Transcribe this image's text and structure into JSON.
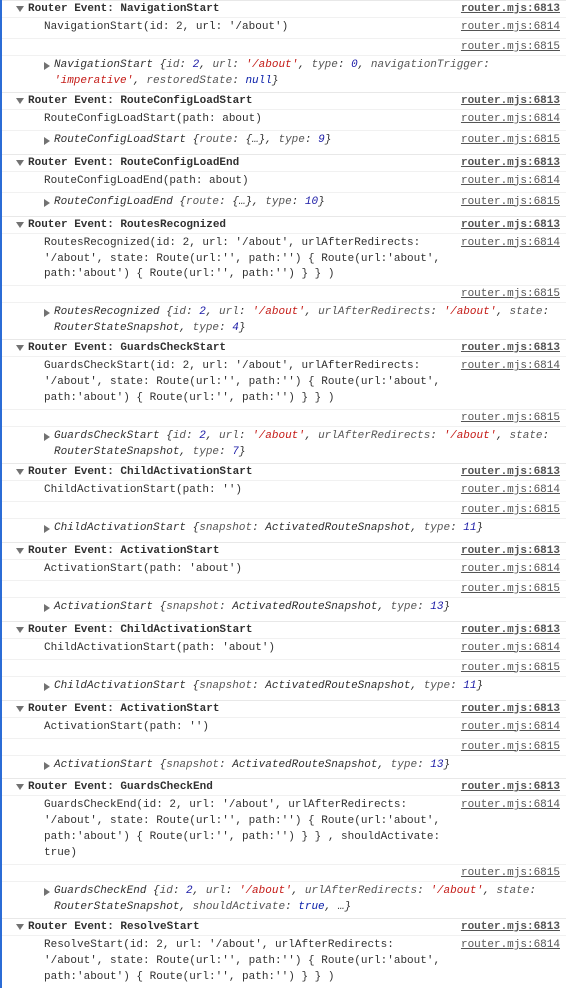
{
  "sources": {
    "s6813": "router.mjs:6813",
    "s6814": "router.mjs:6814",
    "s6815": "router.mjs:6815"
  },
  "groups": [
    {
      "title": "Router Event: NavigationStart",
      "headerSrc": "s6813",
      "rows": [
        {
          "type": "msg",
          "text": "NavigationStart(id: 2, url: '/about')",
          "src": "s6814"
        },
        {
          "type": "srcOnly",
          "src": "s6815"
        },
        {
          "type": "obj",
          "src": null,
          "segments": [
            {
              "t": "plain",
              "v": "NavigationStart {"
            },
            {
              "t": "key",
              "v": "id"
            },
            {
              "t": "plain",
              "v": ": "
            },
            {
              "t": "num",
              "v": "2"
            },
            {
              "t": "plain",
              "v": ", "
            },
            {
              "t": "key",
              "v": "url"
            },
            {
              "t": "plain",
              "v": ": "
            },
            {
              "t": "str",
              "v": "'/about'"
            },
            {
              "t": "plain",
              "v": ", "
            },
            {
              "t": "key",
              "v": "type"
            },
            {
              "t": "plain",
              "v": ": "
            },
            {
              "t": "num",
              "v": "0"
            },
            {
              "t": "plain",
              "v": ", "
            },
            {
              "t": "key",
              "v": "navigationTrigger"
            },
            {
              "t": "plain",
              "v": ": "
            },
            {
              "t": "str",
              "v": "'imperative'"
            },
            {
              "t": "plain",
              "v": ", "
            },
            {
              "t": "key",
              "v": "restoredState"
            },
            {
              "t": "plain",
              "v": ": "
            },
            {
              "t": "lit",
              "v": "null"
            },
            {
              "t": "plain",
              "v": "}"
            }
          ]
        }
      ]
    },
    {
      "title": "Router Event: RouteConfigLoadStart",
      "headerSrc": "s6813",
      "rows": [
        {
          "type": "msg",
          "text": "RouteConfigLoadStart(path: about)",
          "src": "s6814"
        },
        {
          "type": "obj",
          "src": "s6815",
          "segments": [
            {
              "t": "plain",
              "v": "RouteConfigLoadStart {"
            },
            {
              "t": "key",
              "v": "route"
            },
            {
              "t": "plain",
              "v": ": "
            },
            {
              "t": "plain",
              "v": "{…}"
            },
            {
              "t": "plain",
              "v": ", "
            },
            {
              "t": "key",
              "v": "type"
            },
            {
              "t": "plain",
              "v": ": "
            },
            {
              "t": "num",
              "v": "9"
            },
            {
              "t": "plain",
              "v": "}"
            }
          ]
        }
      ]
    },
    {
      "title": "Router Event: RouteConfigLoadEnd",
      "headerSrc": "s6813",
      "rows": [
        {
          "type": "msg",
          "text": "RouteConfigLoadEnd(path: about)",
          "src": "s6814"
        },
        {
          "type": "obj",
          "src": "s6815",
          "segments": [
            {
              "t": "plain",
              "v": "RouteConfigLoadEnd {"
            },
            {
              "t": "key",
              "v": "route"
            },
            {
              "t": "plain",
              "v": ": "
            },
            {
              "t": "plain",
              "v": "{…}"
            },
            {
              "t": "plain",
              "v": ", "
            },
            {
              "t": "key",
              "v": "type"
            },
            {
              "t": "plain",
              "v": ": "
            },
            {
              "t": "num",
              "v": "10"
            },
            {
              "t": "plain",
              "v": "}"
            }
          ]
        }
      ]
    },
    {
      "title": "Router Event: RoutesRecognized",
      "headerSrc": "s6813",
      "rows": [
        {
          "type": "msg",
          "text": "RoutesRecognized(id: 2, url: '/about', urlAfterRedirects: '/about', state: Route(url:'', path:'') { Route(url:'about', path:'about') { Route(url:'', path:'') }  } )",
          "src": "s6814"
        },
        {
          "type": "srcOnly",
          "src": "s6815"
        },
        {
          "type": "obj",
          "src": null,
          "segments": [
            {
              "t": "plain",
              "v": "RoutesRecognized {"
            },
            {
              "t": "key",
              "v": "id"
            },
            {
              "t": "plain",
              "v": ": "
            },
            {
              "t": "num",
              "v": "2"
            },
            {
              "t": "plain",
              "v": ", "
            },
            {
              "t": "key",
              "v": "url"
            },
            {
              "t": "plain",
              "v": ": "
            },
            {
              "t": "str",
              "v": "'/about'"
            },
            {
              "t": "plain",
              "v": ", "
            },
            {
              "t": "key",
              "v": "urlAfterRedirects"
            },
            {
              "t": "plain",
              "v": ": "
            },
            {
              "t": "str",
              "v": "'/about'"
            },
            {
              "t": "plain",
              "v": ", "
            },
            {
              "t": "key",
              "v": "state"
            },
            {
              "t": "plain",
              "v": ": RouterStateSnapshot, "
            },
            {
              "t": "key",
              "v": "type"
            },
            {
              "t": "plain",
              "v": ": "
            },
            {
              "t": "num",
              "v": "4"
            },
            {
              "t": "plain",
              "v": "}"
            }
          ]
        }
      ]
    },
    {
      "title": "Router Event: GuardsCheckStart",
      "headerSrc": "s6813",
      "rows": [
        {
          "type": "msg",
          "text": "GuardsCheckStart(id: 2, url: '/about', urlAfterRedirects: '/about', state: Route(url:'', path:'') { Route(url:'about', path:'about') { Route(url:'', path:'') }  } )",
          "src": "s6814"
        },
        {
          "type": "srcOnly",
          "src": "s6815"
        },
        {
          "type": "obj",
          "src": null,
          "segments": [
            {
              "t": "plain",
              "v": "GuardsCheckStart {"
            },
            {
              "t": "key",
              "v": "id"
            },
            {
              "t": "plain",
              "v": ": "
            },
            {
              "t": "num",
              "v": "2"
            },
            {
              "t": "plain",
              "v": ", "
            },
            {
              "t": "key",
              "v": "url"
            },
            {
              "t": "plain",
              "v": ": "
            },
            {
              "t": "str",
              "v": "'/about'"
            },
            {
              "t": "plain",
              "v": ", "
            },
            {
              "t": "key",
              "v": "urlAfterRedirects"
            },
            {
              "t": "plain",
              "v": ": "
            },
            {
              "t": "str",
              "v": "'/about'"
            },
            {
              "t": "plain",
              "v": ", "
            },
            {
              "t": "key",
              "v": "state"
            },
            {
              "t": "plain",
              "v": ": RouterStateSnapshot, "
            },
            {
              "t": "key",
              "v": "type"
            },
            {
              "t": "plain",
              "v": ": "
            },
            {
              "t": "num",
              "v": "7"
            },
            {
              "t": "plain",
              "v": "}"
            }
          ]
        }
      ]
    },
    {
      "title": "Router Event: ChildActivationStart",
      "headerSrc": "s6813",
      "rows": [
        {
          "type": "msg",
          "text": "ChildActivationStart(path: '')",
          "src": "s6814"
        },
        {
          "type": "srcOnly",
          "src": "s6815"
        },
        {
          "type": "obj",
          "src": null,
          "segments": [
            {
              "t": "plain",
              "v": "ChildActivationStart {"
            },
            {
              "t": "key",
              "v": "snapshot"
            },
            {
              "t": "plain",
              "v": ": ActivatedRouteSnapshot, "
            },
            {
              "t": "key",
              "v": "type"
            },
            {
              "t": "plain",
              "v": ": "
            },
            {
              "t": "num",
              "v": "11"
            },
            {
              "t": "plain",
              "v": "}"
            }
          ]
        }
      ]
    },
    {
      "title": "Router Event: ActivationStart",
      "headerSrc": "s6813",
      "rows": [
        {
          "type": "msg",
          "text": "ActivationStart(path: 'about')",
          "src": "s6814"
        },
        {
          "type": "srcOnly",
          "src": "s6815"
        },
        {
          "type": "obj",
          "src": null,
          "segments": [
            {
              "t": "plain",
              "v": "ActivationStart {"
            },
            {
              "t": "key",
              "v": "snapshot"
            },
            {
              "t": "plain",
              "v": ": ActivatedRouteSnapshot, "
            },
            {
              "t": "key",
              "v": "type"
            },
            {
              "t": "plain",
              "v": ": "
            },
            {
              "t": "num",
              "v": "13"
            },
            {
              "t": "plain",
              "v": "}"
            }
          ]
        }
      ]
    },
    {
      "title": "Router Event: ChildActivationStart",
      "headerSrc": "s6813",
      "rows": [
        {
          "type": "msg",
          "text": "ChildActivationStart(path: 'about')",
          "src": "s6814"
        },
        {
          "type": "srcOnly",
          "src": "s6815"
        },
        {
          "type": "obj",
          "src": null,
          "segments": [
            {
              "t": "plain",
              "v": "ChildActivationStart {"
            },
            {
              "t": "key",
              "v": "snapshot"
            },
            {
              "t": "plain",
              "v": ": ActivatedRouteSnapshot, "
            },
            {
              "t": "key",
              "v": "type"
            },
            {
              "t": "plain",
              "v": ": "
            },
            {
              "t": "num",
              "v": "11"
            },
            {
              "t": "plain",
              "v": "}"
            }
          ]
        }
      ]
    },
    {
      "title": "Router Event: ActivationStart",
      "headerSrc": "s6813",
      "rows": [
        {
          "type": "msg",
          "text": "ActivationStart(path: '')",
          "src": "s6814"
        },
        {
          "type": "srcOnly",
          "src": "s6815"
        },
        {
          "type": "obj",
          "src": null,
          "segments": [
            {
              "t": "plain",
              "v": "ActivationStart {"
            },
            {
              "t": "key",
              "v": "snapshot"
            },
            {
              "t": "plain",
              "v": ": ActivatedRouteSnapshot, "
            },
            {
              "t": "key",
              "v": "type"
            },
            {
              "t": "plain",
              "v": ": "
            },
            {
              "t": "num",
              "v": "13"
            },
            {
              "t": "plain",
              "v": "}"
            }
          ]
        }
      ]
    },
    {
      "title": "Router Event: GuardsCheckEnd",
      "headerSrc": "s6813",
      "rows": [
        {
          "type": "msg",
          "text": "GuardsCheckEnd(id: 2, url: '/about', urlAfterRedirects: '/about', state: Route(url:'', path:'') { Route(url:'about', path:'about') { Route(url:'', path:'') }  } , shouldActivate: true)",
          "src": "s6814"
        },
        {
          "type": "srcOnly",
          "src": "s6815"
        },
        {
          "type": "obj",
          "src": null,
          "segments": [
            {
              "t": "plain",
              "v": "GuardsCheckEnd {"
            },
            {
              "t": "key",
              "v": "id"
            },
            {
              "t": "plain",
              "v": ": "
            },
            {
              "t": "num",
              "v": "2"
            },
            {
              "t": "plain",
              "v": ", "
            },
            {
              "t": "key",
              "v": "url"
            },
            {
              "t": "plain",
              "v": ": "
            },
            {
              "t": "str",
              "v": "'/about'"
            },
            {
              "t": "plain",
              "v": ", "
            },
            {
              "t": "key",
              "v": "urlAfterRedirects"
            },
            {
              "t": "plain",
              "v": ": "
            },
            {
              "t": "str",
              "v": "'/about'"
            },
            {
              "t": "plain",
              "v": ", "
            },
            {
              "t": "key",
              "v": "state"
            },
            {
              "t": "plain",
              "v": ": RouterStateSnapshot, "
            },
            {
              "t": "key",
              "v": "shouldActivate"
            },
            {
              "t": "plain",
              "v": ": "
            },
            {
              "t": "lit",
              "v": "true"
            },
            {
              "t": "plain",
              "v": ", …}"
            }
          ]
        }
      ]
    },
    {
      "title": "Router Event: ResolveStart",
      "headerSrc": "s6813",
      "rows": [
        {
          "type": "msg",
          "text": "ResolveStart(id: 2, url: '/about', urlAfterRedirects: '/about', state: Route(url:'', path:'') { Route(url:'about', path:'about') { Route(url:'', path:'') }  } )",
          "src": "s6814",
          "cut": true
        }
      ]
    }
  ]
}
